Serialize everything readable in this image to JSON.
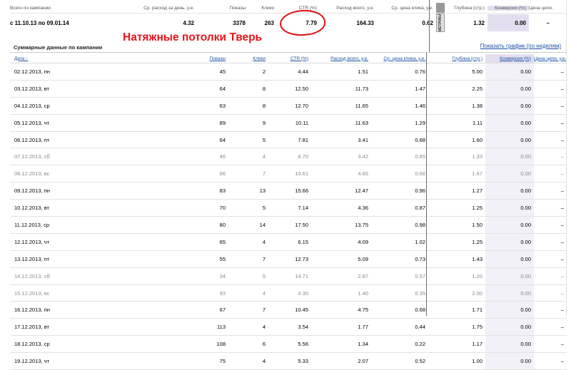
{
  "summary": {
    "headers": {
      "period": "Всего по кампании",
      "avg_spend": "Ср. расход за день, у.е.",
      "impressions": "Показы",
      "clicks": "Клики",
      "ctr": "CTR (%)",
      "total_spend": "Расход всего, у.е.",
      "avg_cpc": "Ср. цена клика, у.е.",
      "metrika_tab": "МЕТРИКА",
      "depth": "Глубина (стр.)",
      "conversion": "Конверсия (%)",
      "goal_price": "Цена цели, у.е."
    },
    "row": {
      "period": "с 11.10.13 по 09.01.14",
      "avg_spend": "4.32",
      "impressions": "3378",
      "clicks": "263",
      "ctr": "7.79",
      "total_spend": "164.33",
      "avg_cpc": "0.62",
      "depth": "1.32",
      "conversion": "0.00",
      "goal_price": "–"
    }
  },
  "annotation": "Натяжные потолки Тверь",
  "section": {
    "title": "Суммарные данные по кампании",
    "graph_link": "Показать график (по неделям)"
  },
  "table": {
    "columns": [
      "Дата ↑",
      "Показы",
      "Клики",
      "CTR (%)",
      "Расход всего, у.е.",
      "Ср. цена клика, у.е.",
      "Глубина (стр.)",
      "Конверсия (%)",
      "Цена цели, у.е."
    ],
    "rows": [
      [
        "02.12.2013, пн",
        "45",
        "2",
        "4.44",
        "1.51",
        "0.76",
        "5.00",
        "0.00",
        "–"
      ],
      [
        "03.12.2013, вт",
        "64",
        "8",
        "12.50",
        "11.73",
        "1.47",
        "2.25",
        "0.00",
        "–"
      ],
      [
        "04.12.2013, ср",
        "63",
        "8",
        "12.70",
        "11.65",
        "1.46",
        "1.38",
        "0.00",
        "–"
      ],
      [
        "05.12.2013, чт",
        "89",
        "9",
        "10.11",
        "11.63",
        "1.29",
        "1.11",
        "0.00",
        "–"
      ],
      [
        "06.12.2013, пт",
        "64",
        "5",
        "7.81",
        "3.41",
        "0.68",
        "1.60",
        "0.00",
        "–"
      ],
      [
        "07.12.2013, сб",
        "46",
        "4",
        "8.70",
        "3.42",
        "0.85",
        "1.33",
        "0.00",
        "–"
      ],
      [
        "08.12.2013, вс",
        "66",
        "7",
        "10.61",
        "4.65",
        "0.66",
        "1.67",
        "0.00",
        "–"
      ],
      [
        "09.12.2013, пн",
        "83",
        "13",
        "15.66",
        "12.47",
        "0.96",
        "1.27",
        "0.00",
        "–"
      ],
      [
        "10.12.2013, вт",
        "70",
        "5",
        "7.14",
        "4.36",
        "0.87",
        "1.25",
        "0.00",
        "–"
      ],
      [
        "11.12.2013, ср",
        "80",
        "14",
        "17.50",
        "13.75",
        "0.98",
        "1.50",
        "0.00",
        "–"
      ],
      [
        "12.12.2013, чт",
        "65",
        "4",
        "6.15",
        "4.09",
        "1.02",
        "1.25",
        "0.00",
        "–"
      ],
      [
        "13.12.2013, пт",
        "55",
        "7",
        "12.73",
        "5.09",
        "0.73",
        "1.43",
        "0.00",
        "–"
      ],
      [
        "14.12.2013, сб",
        "34",
        "5",
        "14.71",
        "2.87",
        "0.57",
        "1.20",
        "0.00",
        "–"
      ],
      [
        "15.12.2013, вс",
        "93",
        "4",
        "4.30",
        "1.40",
        "0.35",
        "2.00",
        "0.00",
        "–"
      ],
      [
        "16.12.2013, пн",
        "67",
        "7",
        "10.45",
        "4.75",
        "0.68",
        "1.71",
        "0.00",
        "–"
      ],
      [
        "17.12.2013, вт",
        "113",
        "4",
        "3.54",
        "1.77",
        "0.44",
        "1.75",
        "0.00",
        "–"
      ],
      [
        "18.12.2013, ср",
        "108",
        "6",
        "5.56",
        "1.34",
        "0.22",
        "1.17",
        "0.00",
        "–"
      ],
      [
        "19.12.2013, чт",
        "75",
        "4",
        "5.33",
        "2.07",
        "0.52",
        "1.00",
        "0.00",
        "–"
      ]
    ],
    "weekend_rows": [
      5,
      6,
      12,
      13
    ]
  },
  "colors": {
    "annotation": "#e8141c",
    "link": "#1a4fa0",
    "conversion_column": "#e3dff0"
  }
}
